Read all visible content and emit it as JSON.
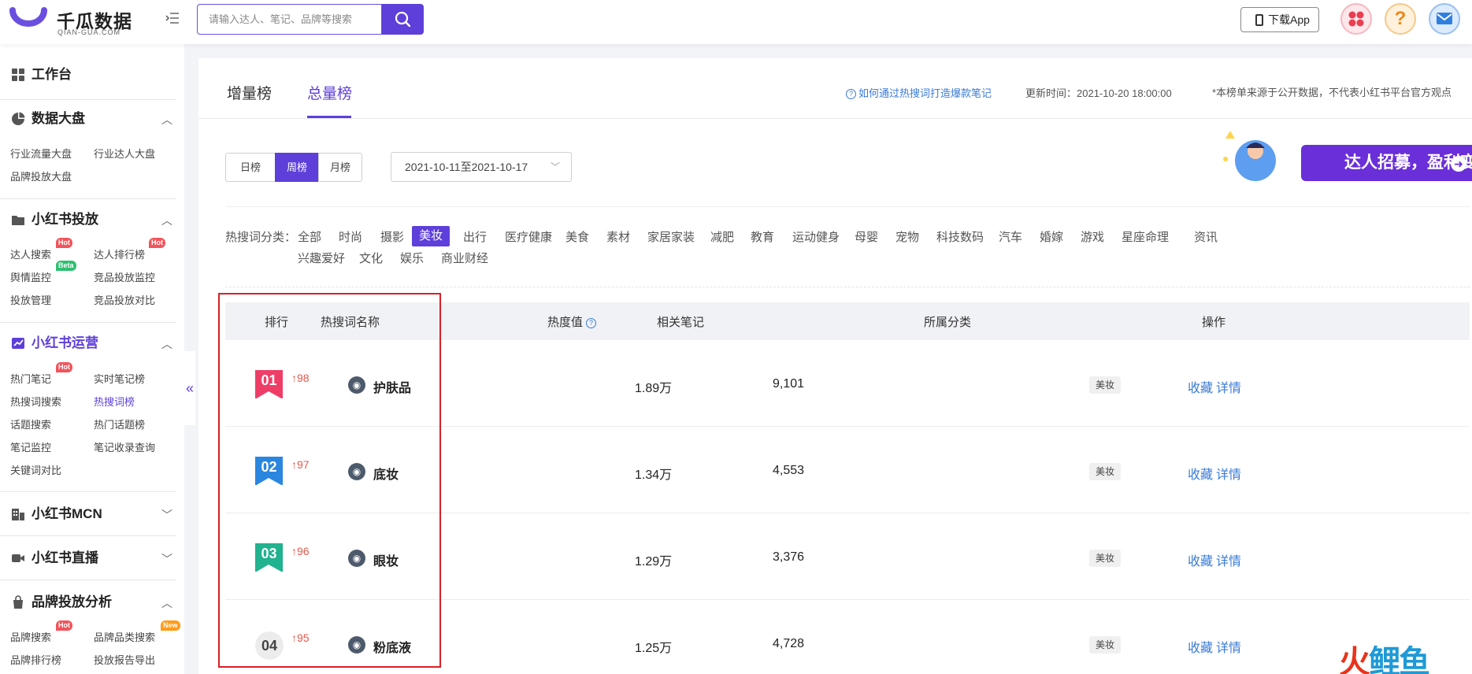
{
  "header": {
    "logo_title": "千瓜数据",
    "logo_sub": "QIAN-GUA.COM",
    "search_placeholder": "请输入达人、笔记、品牌等搜索",
    "download_label": "下载App"
  },
  "sidebar": {
    "workbench": "工作台",
    "sections": [
      {
        "title": "数据大盘",
        "items": [
          "行业流量大盘",
          "行业达人大盘",
          "品牌投放大盘"
        ]
      },
      {
        "title": "小红书投放",
        "items": [
          "达人搜索",
          "达人排行榜",
          "舆情监控",
          "竞品投放监控",
          "投放管理",
          "竞品投放对比"
        ]
      },
      {
        "title": "小红书运营",
        "items": [
          "热门笔记",
          "实时笔记榜",
          "热搜词搜索",
          "热搜词榜",
          "话题搜索",
          "热门话题榜",
          "笔记监控",
          "笔记收录查询",
          "关键词对比"
        ]
      },
      {
        "title": "小红书MCN",
        "items": []
      },
      {
        "title": "小红书直播",
        "items": []
      },
      {
        "title": "品牌投放分析",
        "items": [
          "品牌搜索",
          "品牌品类搜索",
          "品牌排行榜",
          "投放报告导出"
        ]
      }
    ],
    "badges": {
      "hot": "Hot",
      "beta": "Beta",
      "new": "New"
    },
    "collapse_glyph": "«"
  },
  "main": {
    "tabs": [
      "增量榜",
      "总量榜"
    ],
    "active_tab": "总量榜",
    "help_link": "如何通过热搜词打造爆款笔记",
    "update_time": "更新时间：2021-10-20 18:00:00",
    "disclaimer": "*本榜单来源于公开数据，不代表小红书平台官方观点",
    "periods": [
      "日榜",
      "周榜",
      "月榜"
    ],
    "active_period": "周榜",
    "date_range": "2021-10-11至2021-10-17",
    "banner_text": "达人招募，盈利变现",
    "category_label": "热搜词分类：",
    "categories": [
      "全部",
      "时尚",
      "摄影",
      "美妆",
      "出行",
      "医疗健康",
      "美食",
      "素材",
      "家居家装",
      "减肥",
      "教育",
      "运动健身",
      "母婴",
      "宠物",
      "科技数码",
      "汽车",
      "婚嫁",
      "游戏",
      "星座命理",
      "资讯",
      "兴趣爱好",
      "文化",
      "娱乐",
      "商业财经"
    ],
    "active_category": "美妆",
    "table": {
      "headers": {
        "rank": "排行",
        "name": "热搜词名称",
        "heat": "热度值",
        "notes": "相关笔记",
        "category": "所属分类",
        "ops": "操作"
      },
      "rows": [
        {
          "rank": "01",
          "delta": "98",
          "keyword": "护肤品",
          "heat": "1.89万",
          "notes": "9,101",
          "category": "美妆"
        },
        {
          "rank": "02",
          "delta": "97",
          "keyword": "底妆",
          "heat": "1.34万",
          "notes": "4,553",
          "category": "美妆"
        },
        {
          "rank": "03",
          "delta": "96",
          "keyword": "眼妆",
          "heat": "1.29万",
          "notes": "3,376",
          "category": "美妆"
        },
        {
          "rank": "04",
          "delta": "95",
          "keyword": "粉底液",
          "heat": "1.25万",
          "notes": "4,728",
          "category": "美妆"
        }
      ],
      "op_favorite": "收藏",
      "op_detail": "详情"
    }
  },
  "watermark": {
    "part1": "火",
    "part2": "鲤鱼"
  },
  "colors": {
    "accent": "#5e3fd9",
    "link": "#3a7bd5",
    "delta": "#e8584c",
    "highlight_box": "#d92027"
  }
}
